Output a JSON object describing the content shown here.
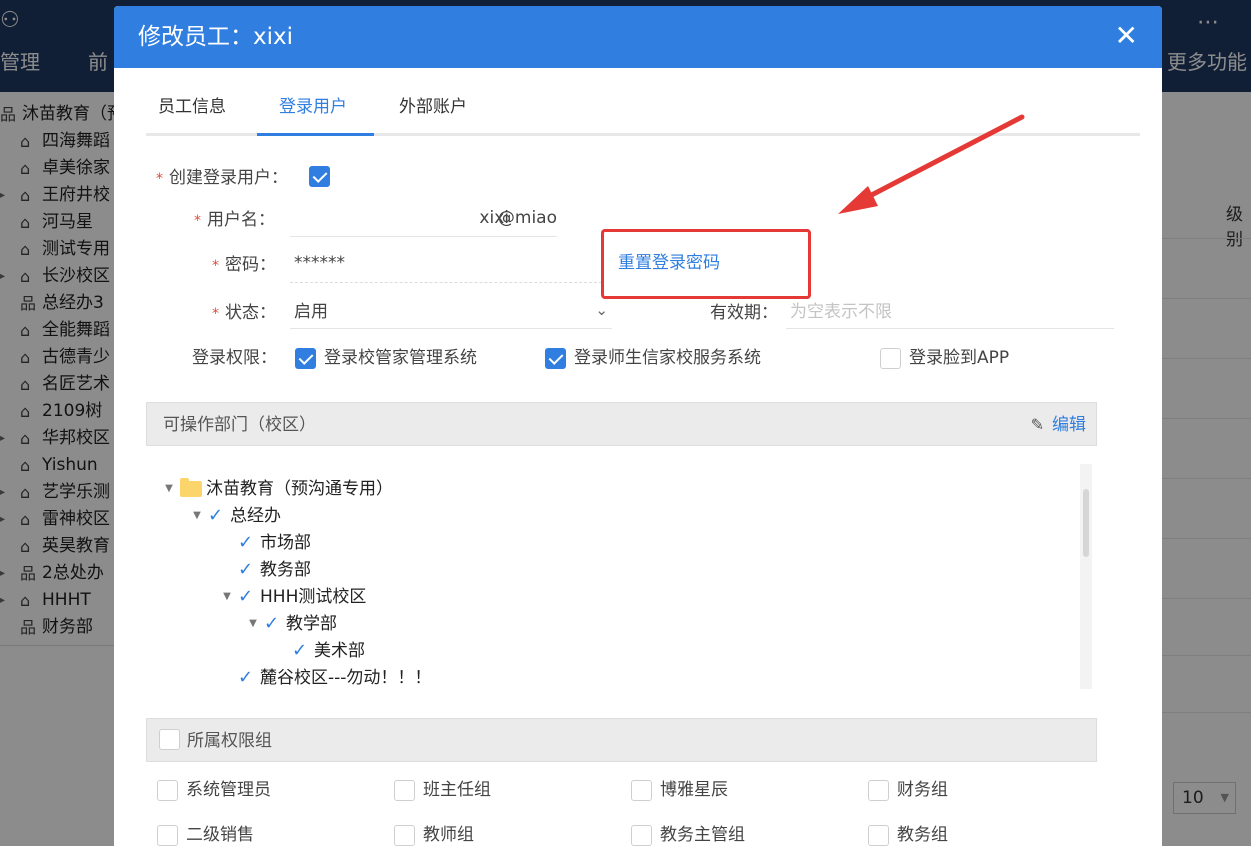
{
  "background": {
    "nav": [
      {
        "label": "管理"
      },
      {
        "label": "前"
      },
      {
        "label": "更多功能"
      }
    ],
    "tree_items": [
      {
        "label": "沐苗教育（预",
        "icon": "org-icon"
      },
      {
        "label": "四海舞蹈",
        "icon": "home-icon"
      },
      {
        "label": "卓美徐家",
        "icon": "home-icon"
      },
      {
        "label": "王府井校",
        "icon": "home-icon"
      },
      {
        "label": "河马星",
        "icon": "home-icon"
      },
      {
        "label": "测试专用",
        "icon": "home-icon"
      },
      {
        "label": "长沙校区",
        "icon": "home-icon"
      },
      {
        "label": "总经办3",
        "icon": "org-icon"
      },
      {
        "label": "全能舞蹈",
        "icon": "home-icon"
      },
      {
        "label": "古德青少",
        "icon": "home-icon"
      },
      {
        "label": "名匠艺术",
        "icon": "home-icon"
      },
      {
        "label": "2109树",
        "icon": "home-icon"
      },
      {
        "label": "华邦校区",
        "icon": "home-icon"
      },
      {
        "label": "Yishun",
        "icon": "home-icon"
      },
      {
        "label": "艺学乐测",
        "icon": "home-icon"
      },
      {
        "label": "雷神校区",
        "icon": "home-icon"
      },
      {
        "label": "英昊教育",
        "icon": "home-icon"
      },
      {
        "label": "2总处办",
        "icon": "org-icon"
      },
      {
        "label": "HHHT",
        "icon": "home-icon"
      },
      {
        "label": "财务部",
        "icon": "org-icon"
      }
    ],
    "column_header": "级别",
    "page_size": "10"
  },
  "modal": {
    "title": "修改员工：xixi",
    "close_icon": "close-icon",
    "tabs": [
      {
        "label": "员工信息"
      },
      {
        "label": "登录用户"
      },
      {
        "label": "外部账户"
      }
    ],
    "form": {
      "create_login": {
        "label": "创建登录用户：",
        "checked": true
      },
      "username": {
        "label": "用户名：",
        "value": "xixi",
        "suffix": "@miao"
      },
      "password": {
        "label": "密码：",
        "value": "******"
      },
      "reset_password_link": "重置登录密码",
      "status": {
        "label": "状态：",
        "value": "启用"
      },
      "validity": {
        "label": "有效期：",
        "placeholder": "为空表示不限"
      },
      "login_perms": {
        "label": "登录权限：",
        "items": [
          {
            "label": "登录校管家管理系统",
            "checked": true
          },
          {
            "label": "登录师生信家校服务系统",
            "checked": true
          },
          {
            "label": "登录脸到APP",
            "checked": false
          }
        ]
      }
    },
    "departments": {
      "title": "可操作部门（校区）",
      "edit_label": "编辑",
      "tree": [
        {
          "label": "沐苗教育（预沟通专用）",
          "type": "folder"
        },
        {
          "label": "总经办",
          "type": "checked"
        },
        {
          "label": "市场部",
          "type": "checked"
        },
        {
          "label": "教务部",
          "type": "checked"
        },
        {
          "label": "HHH测试校区",
          "type": "checked"
        },
        {
          "label": "教学部",
          "type": "checked"
        },
        {
          "label": "美术部",
          "type": "checked"
        },
        {
          "label": "麓谷校区---勿动！！！",
          "type": "checked"
        }
      ]
    },
    "roles": {
      "title": "所属权限组",
      "items": [
        {
          "label": "系统管理员",
          "checked": false
        },
        {
          "label": "班主任组",
          "checked": false
        },
        {
          "label": "博雅星辰",
          "checked": false
        },
        {
          "label": "财务组",
          "checked": false
        },
        {
          "label": "二级销售",
          "checked": false
        },
        {
          "label": "教师组",
          "checked": false
        },
        {
          "label": "教务主管组",
          "checked": false
        },
        {
          "label": "教务组",
          "checked": false
        }
      ]
    }
  },
  "colors": {
    "primary": "#2f7ee0",
    "header_bg": "#1e3a63",
    "required": "#e24b3b",
    "annotation": "#e53935"
  }
}
